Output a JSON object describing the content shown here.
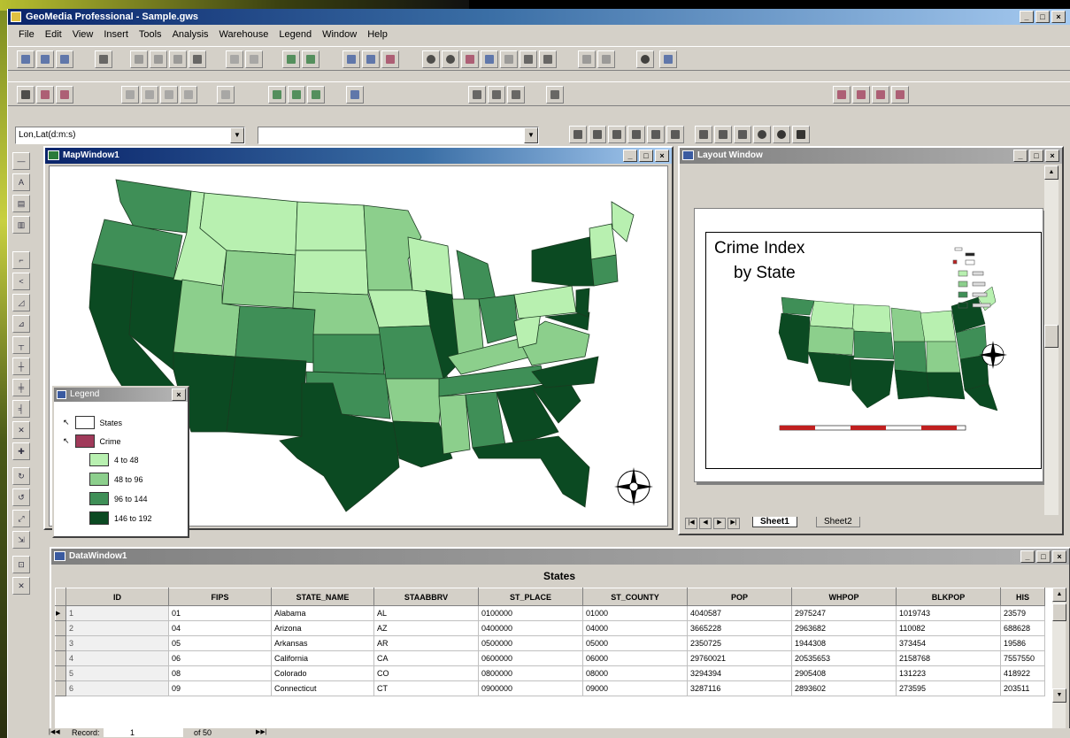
{
  "app": {
    "title": "GeoMedia Professional - Sample.gws"
  },
  "menu": [
    "File",
    "Edit",
    "View",
    "Insert",
    "Tools",
    "Analysis",
    "Warehouse",
    "Legend",
    "Window",
    "Help"
  ],
  "toolbar": {
    "coord_combo": "Lon,Lat(d:m:s)",
    "location_combo": ""
  },
  "map_window": {
    "title": "MapWindow1"
  },
  "legend": {
    "title": "Legend",
    "items": [
      {
        "label": "States"
      },
      {
        "label": "Crime"
      }
    ],
    "classes": [
      {
        "label": "4 to 48",
        "color": "#b8f0b0"
      },
      {
        "label": "48 to 96",
        "color": "#8ccf8c"
      },
      {
        "label": "96 to 144",
        "color": "#3f8f57"
      },
      {
        "label": "146 to 192",
        "color": "#0b4a22"
      }
    ]
  },
  "layout_window": {
    "title": "Layout Window",
    "heading_line1": "Crime Index",
    "heading_line2": "by State",
    "tabs": [
      "Sheet1",
      "Sheet2"
    ]
  },
  "data_window": {
    "title": "DataWindow1",
    "table_title": "States",
    "columns": [
      "ID",
      "FIPS",
      "STATE_NAME",
      "STAABBRV",
      "ST_PLACE",
      "ST_COUNTY",
      "POP",
      "WHPOP",
      "BLKPOP",
      "HIS"
    ],
    "rows": [
      [
        "1",
        "01",
        "Alabama",
        "AL",
        "0100000",
        "01000",
        "4040587",
        "2975247",
        "1019743",
        "23579"
      ],
      [
        "2",
        "04",
        "Arizona",
        "AZ",
        "0400000",
        "04000",
        "3665228",
        "2963682",
        "110082",
        "688628"
      ],
      [
        "3",
        "05",
        "Arkansas",
        "AR",
        "0500000",
        "05000",
        "2350725",
        "1944308",
        "373454",
        "19586"
      ],
      [
        "4",
        "06",
        "California",
        "CA",
        "0600000",
        "06000",
        "29760021",
        "20535653",
        "2158768",
        "7557550"
      ],
      [
        "5",
        "08",
        "Colorado",
        "CO",
        "0800000",
        "08000",
        "3294394",
        "2905408",
        "131223",
        "418922"
      ],
      [
        "6",
        "09",
        "Connecticut",
        "CT",
        "0900000",
        "09000",
        "3287116",
        "2893602",
        "273595",
        "203511"
      ]
    ]
  },
  "record_bar": {
    "label": "Record:",
    "value": "1",
    "of_label": "of 50"
  },
  "colors": {
    "accent": "#0a246a",
    "panel": "#d4d0c8"
  }
}
